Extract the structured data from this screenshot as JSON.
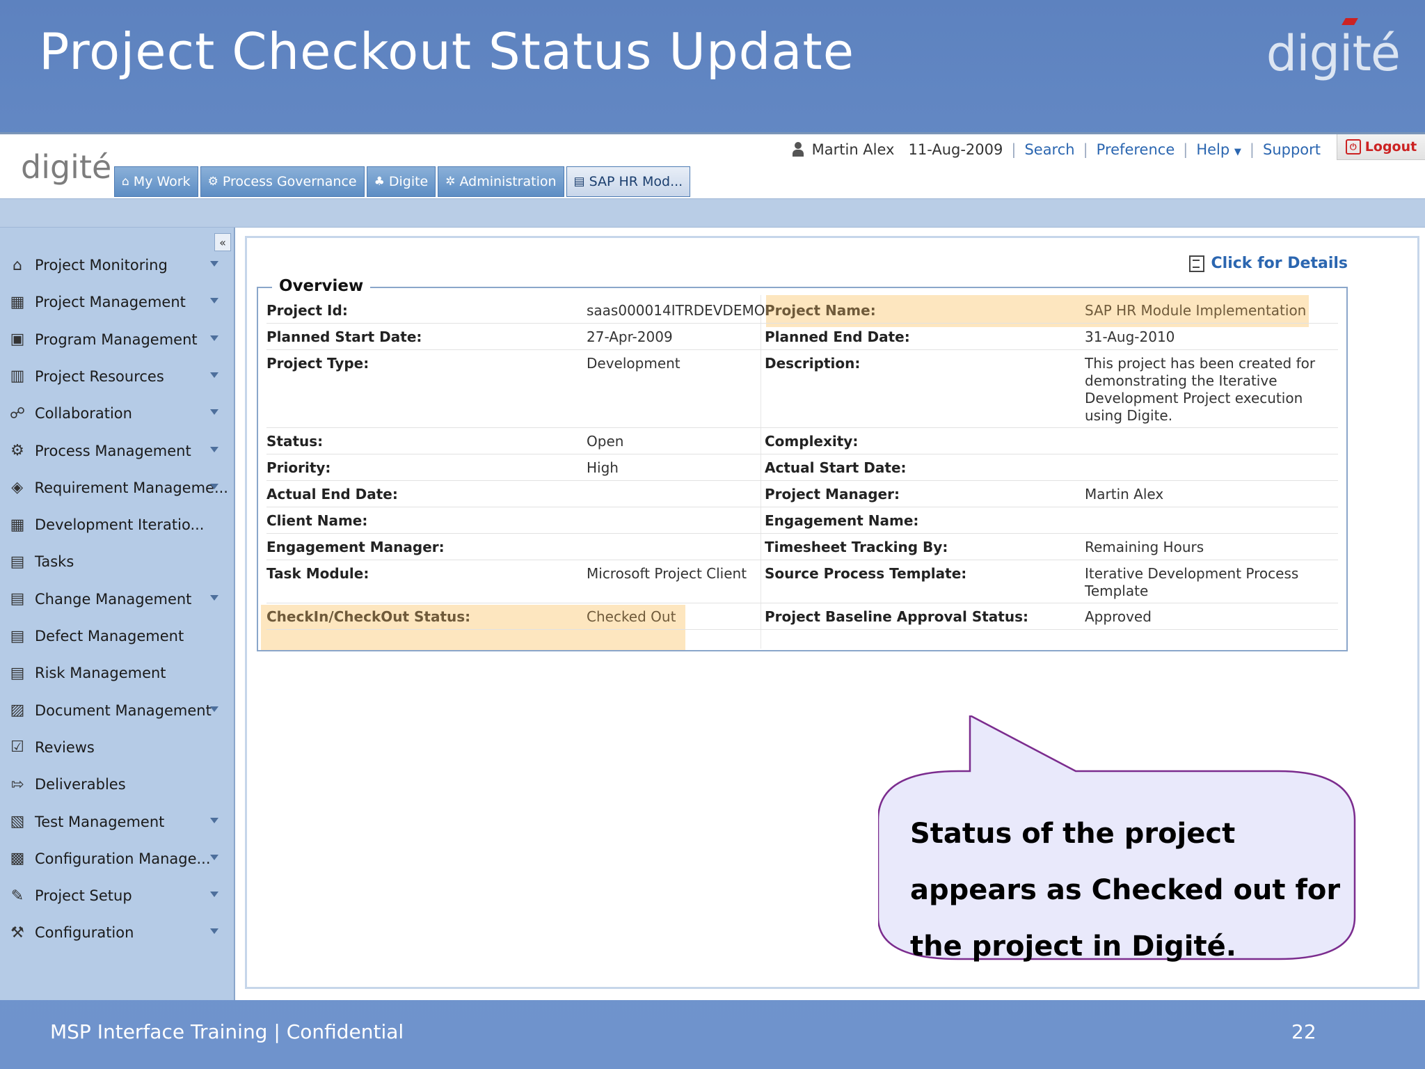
{
  "slide": {
    "title": "Project Checkout Status Update",
    "logo_text": "digité",
    "footer": "MSP Interface Training | Confidential",
    "page_number": "22"
  },
  "app": {
    "logo_text": "digité",
    "user": {
      "name": "Martin Alex",
      "date": "11-Aug-2009",
      "links": [
        "Search",
        "Preference",
        "Help",
        "Support"
      ],
      "logout": "Logout"
    },
    "tabs": [
      {
        "label": "My Work",
        "icon": "home-icon",
        "glyph": "⌂"
      },
      {
        "label": "Process Governance",
        "icon": "gear-icon",
        "glyph": "⚙"
      },
      {
        "label": "Digite",
        "icon": "people-icon",
        "glyph": "♣"
      },
      {
        "label": "Administration",
        "icon": "admin-icon",
        "glyph": "✲"
      },
      {
        "label": "SAP HR Mod...",
        "icon": "project-icon",
        "glyph": "▤"
      }
    ],
    "sidebar": [
      {
        "label": "Project Monitoring",
        "icon": "home-icon",
        "glyph": "⌂",
        "arrow": true
      },
      {
        "label": "Project Management",
        "icon": "project-management-icon",
        "glyph": "▦",
        "arrow": true
      },
      {
        "label": "Program Management",
        "icon": "program-icon",
        "glyph": "▣",
        "arrow": true
      },
      {
        "label": "Project Resources",
        "icon": "resources-icon",
        "glyph": "▥",
        "arrow": true
      },
      {
        "label": "Collaboration",
        "icon": "collaboration-icon",
        "glyph": "☍",
        "arrow": true
      },
      {
        "label": "Process Management",
        "icon": "process-icon",
        "glyph": "⚙",
        "arrow": true
      },
      {
        "label": "Requirement Manageme...",
        "icon": "requirement-icon",
        "glyph": "◈",
        "arrow": true
      },
      {
        "label": "Development Iteratio...",
        "icon": "calendar-icon",
        "glyph": "▦",
        "arrow": false
      },
      {
        "label": "Tasks",
        "icon": "tasks-icon",
        "glyph": "▤",
        "arrow": false
      },
      {
        "label": "Change Management",
        "icon": "change-icon",
        "glyph": "▤",
        "arrow": true
      },
      {
        "label": "Defect Management",
        "icon": "defect-icon",
        "glyph": "▤",
        "arrow": false
      },
      {
        "label": "Risk Management",
        "icon": "risk-icon",
        "glyph": "▤",
        "arrow": false
      },
      {
        "label": "Document Management",
        "icon": "document-icon",
        "glyph": "▨",
        "arrow": true
      },
      {
        "label": "Reviews",
        "icon": "reviews-icon",
        "glyph": "☑",
        "arrow": false
      },
      {
        "label": "Deliverables",
        "icon": "deliverables-icon",
        "glyph": "⇰",
        "arrow": false
      },
      {
        "label": "Test Management",
        "icon": "test-icon",
        "glyph": "▧",
        "arrow": true
      },
      {
        "label": "Configuration Manage...",
        "icon": "config-management-icon",
        "glyph": "▩",
        "arrow": true
      },
      {
        "label": "Project Setup",
        "icon": "setup-icon",
        "glyph": "✎",
        "arrow": true
      },
      {
        "label": "Configuration",
        "icon": "configuration-icon",
        "glyph": "⚒",
        "arrow": true
      }
    ],
    "details_link": "Click for Details",
    "overview": {
      "legend": "Overview",
      "rows": [
        {
          "l1": "Project Id:",
          "v1": "saas000014ITRDEVDEMO",
          "l2": "Project Name:",
          "v2": "SAP HR Module Implementation"
        },
        {
          "l1": "Planned Start Date:",
          "v1": "27-Apr-2009",
          "l2": "Planned End Date:",
          "v2": "31-Aug-2010"
        },
        {
          "l1": "Project Type:",
          "v1": "Development",
          "l2": "Description:",
          "v2": "This project has been created for demonstrating the Iterative Development Project execution using Digite."
        },
        {
          "l1": "Status:",
          "v1": "Open",
          "l2": "Complexity:",
          "v2": ""
        },
        {
          "l1": "Priority:",
          "v1": "High",
          "l2": "Actual Start Date:",
          "v2": ""
        },
        {
          "l1": "Actual End Date:",
          "v1": "",
          "l2": "Project Manager:",
          "v2": "Martin Alex"
        },
        {
          "l1": "Client Name:",
          "v1": "",
          "l2": "Engagement Name:",
          "v2": ""
        },
        {
          "l1": "Engagement Manager:",
          "v1": "",
          "l2": "Timesheet Tracking By:",
          "v2": "Remaining Hours"
        },
        {
          "l1": "Task Module:",
          "v1": "Microsoft Project Client",
          "l2": "Source Process Template:",
          "v2": "Iterative Development Process Template"
        },
        {
          "l1": "CheckIn/CheckOut Status:",
          "v1": "Checked Out",
          "l2": "Project Baseline Approval Status:",
          "v2": "Approved"
        }
      ]
    }
  },
  "callout": {
    "text": "Status of the project appears as Checked out for the project in Digité."
  }
}
